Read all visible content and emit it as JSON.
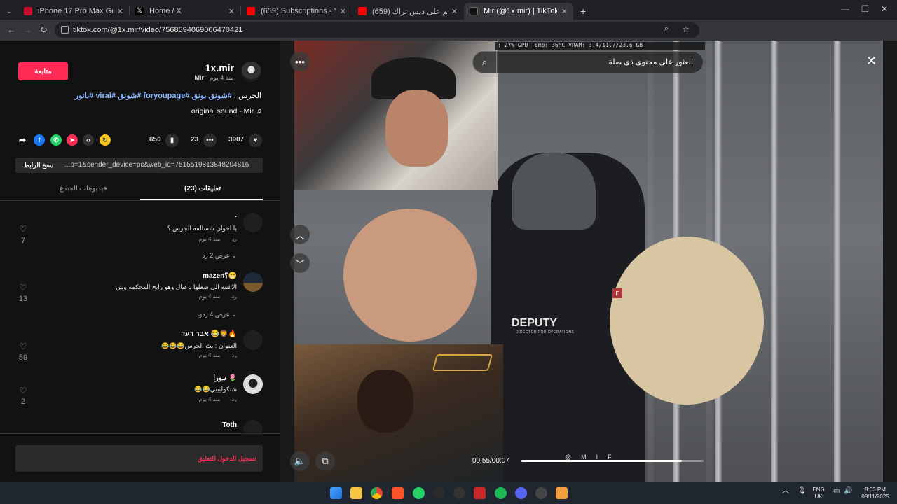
{
  "browser": {
    "tabs": [
      {
        "title": "iPhone 17 Pro Max Get it now",
        "color": "#c8102e"
      },
      {
        "title": "Home / X",
        "color": "#000000"
      },
      {
        "title": "(659) Subscriptions - YouTube",
        "color": "#ff0000"
      },
      {
        "title": "(659) رد فعل وائم على ديس تراك",
        "color": "#ff0000"
      },
      {
        "title": "Mir (@1x.mir) | TikTok",
        "color": "#111111"
      }
    ],
    "new_tab": "+",
    "url": "tiktok.com/@1x.mir/video/7568594069006470421"
  },
  "post": {
    "follow_label": "متابعة",
    "author_name": "1x.mir",
    "author_handle": "Mir",
    "author_time": "منذ 4 يوم",
    "caption_plain": "الجرس !",
    "caption_tags": "#شونق بونق #foryoupage #شونق #viral #بانور",
    "sound": "original sound - Mir",
    "likes": "3907",
    "comments": "23",
    "saves": "650",
    "link": "...p=1&sender_device=pc&web_id=7515519813848204816",
    "copy_link": "نسخ الرابط",
    "tab_comments": "(23) تعليقات",
    "tab_creator_videos": "فيديوهات المبدع",
    "login_prompt": "تسجيل الدخول للتعليق"
  },
  "comments": [
    {
      "name": ".",
      "text": "يا اخوان شسالفه الجرس ؟",
      "time": "منذ 4 يوم",
      "reply": "رد",
      "more": "عرض 2 رد",
      "likes": "7"
    },
    {
      "name": "mazen؟😁",
      "text": "الاغنيه الي شغلها ياعيال وهو رايح المحكمه وش",
      "time": "منذ 4 يوم",
      "reply": "رد",
      "more": "عرض 4 ردود",
      "likes": "13"
    },
    {
      "name": "אבר רעד 😂🦁🔥",
      "text": "العنوان : بث الجرس😂😂😂",
      "time": "منذ 4 يوم",
      "reply": "رد",
      "more": "",
      "likes": "59"
    },
    {
      "name": "نـورا 🌷",
      "text": "شنكوليييي😂😂",
      "time": "منذ 4 يوم",
      "reply": "رد",
      "more": "",
      "likes": "2"
    },
    {
      "name": "Toth",
      "text": "",
      "time": "",
      "reply": "",
      "more": "",
      "likes": ""
    }
  ],
  "video": {
    "search_text": "العثور على محتوى ذي صلة",
    "time": "00:55/00:07",
    "progress": 0.88,
    "watermark": "@MIF",
    "gpu_overlay": ": 27%   GPU Temp: 36°C  VRAM: 3.4/11.7/23.6 GB",
    "deputy": "DEPUTY",
    "deputy_sub": "DIRECTOR FOR OPERATIONS",
    "marker": "E"
  },
  "taskbar": {
    "lang_top": "ENG",
    "lang_bottom": "UK",
    "time": "8:03 PM",
    "date": "08/11/2025"
  }
}
